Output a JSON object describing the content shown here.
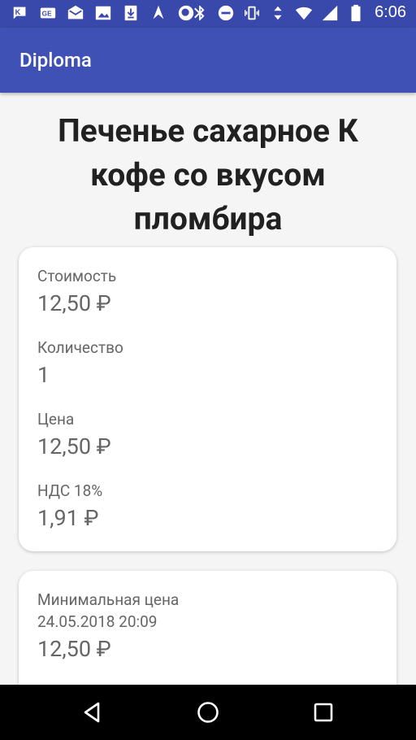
{
  "status_bar": {
    "time": "6:06",
    "left_icons": [
      "k-icon",
      "ge-icon",
      "mail-icon",
      "image-icon",
      "download-icon",
      "vpn-icon",
      "search-notification-icon"
    ],
    "right_icons": [
      "bluetooth-icon",
      "dnd-icon",
      "vibrate-icon",
      "data-arrows-icon",
      "wifi-icon",
      "signal-icon",
      "battery-icon"
    ]
  },
  "app_bar": {
    "title": "Diploma"
  },
  "product": {
    "title": "Печенье сахарное К кофе со вкусом пломбира"
  },
  "card1": {
    "cost_label": "Стоимость",
    "cost_value": "12,50 ₽",
    "quantity_label": "Количество",
    "quantity_value": "1",
    "price_label": "Цена",
    "price_value": "12,50 ₽",
    "vat_label": "НДС 18%",
    "vat_value": "1,91 ₽"
  },
  "card2": {
    "min_price_label": "Минимальная цена",
    "min_price_date": "24.05.2018 20:09",
    "min_price_value": "12,50 ₽"
  },
  "colors": {
    "status_bar": "#3949ab",
    "app_bar": "#3f51b5",
    "background": "#f5f5f5",
    "text_primary": "#212121",
    "text_secondary": "#666666"
  }
}
